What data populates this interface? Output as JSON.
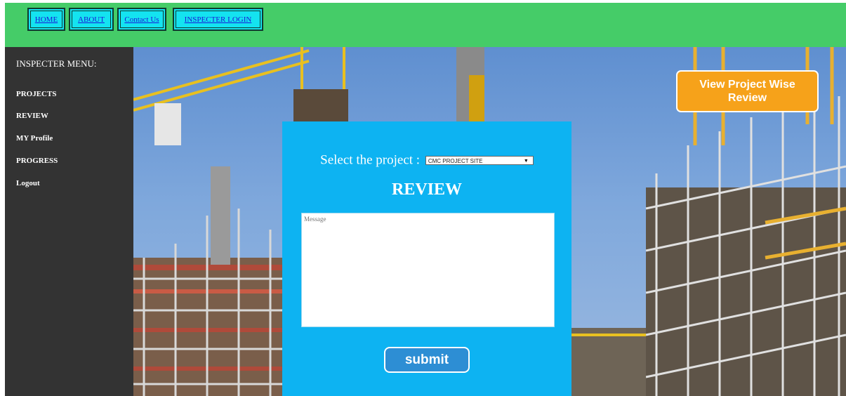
{
  "nav": {
    "home": "HOME",
    "about": "ABOUT",
    "contact": "Contact Us",
    "inspecter_login": "INSPECTER LOGIN"
  },
  "sidebar": {
    "title": "INSPECTER MENU:",
    "items": [
      {
        "label": "PROJECTS"
      },
      {
        "label": "REVIEW"
      },
      {
        "label": "MY Profile"
      },
      {
        "label": "PROGRESS"
      },
      {
        "label": "Logout"
      }
    ]
  },
  "form": {
    "select_label": "Select the project :",
    "selected_project": "CMC PROJECT SITE",
    "heading": "REVIEW",
    "message_placeholder": "Message",
    "submit_label": "submit"
  },
  "review_button_label": "View Project Wise Review",
  "colors": {
    "topbar": "#45cc68",
    "nav_button": "#14e3f0",
    "sidebar": "#333333",
    "panel": "#0db3f2",
    "submit": "#2d8ed4",
    "review_button": "#f6a21a"
  }
}
